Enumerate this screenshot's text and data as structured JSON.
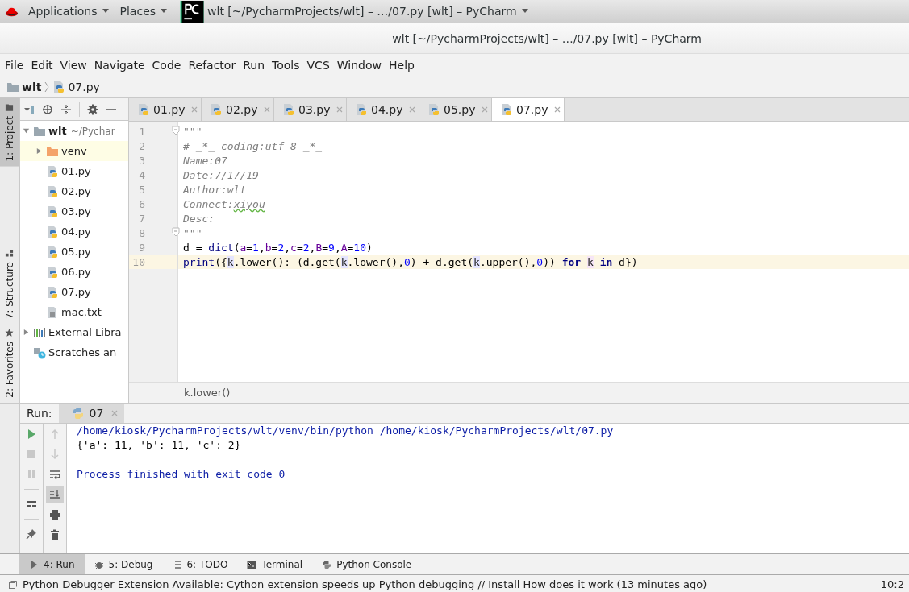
{
  "top_bar": {
    "menus": [
      "Applications",
      "Places"
    ],
    "window_title": "wlt [~/PycharmProjects/wlt] – …/07.py [wlt] – PyCharm"
  },
  "window": {
    "title": "wlt [~/PycharmProjects/wlt] – …/07.py [wlt] – PyCharm"
  },
  "menu_bar": [
    "File",
    "Edit",
    "View",
    "Navigate",
    "Code",
    "Refactor",
    "Run",
    "Tools",
    "VCS",
    "Window",
    "Help"
  ],
  "breadcrumb": [
    {
      "label": "wlt",
      "kind": "folder"
    },
    {
      "label": "07.py",
      "kind": "py"
    }
  ],
  "side_stripe": {
    "top": [
      {
        "label": "1: Project",
        "selected": true
      }
    ],
    "bottom": [
      {
        "label": "7: Structure",
        "selected": false
      },
      {
        "label": "2: Favorites",
        "selected": false
      }
    ]
  },
  "project_tree": [
    {
      "label": "wlt",
      "hint": "~/Pychar",
      "kind": "folder",
      "expanded": true,
      "selected": false,
      "children": [
        {
          "label": "venv",
          "kind": "venv",
          "expanded": false,
          "selected": true
        },
        {
          "label": "01.py",
          "kind": "py",
          "selected": false
        },
        {
          "label": "02.py",
          "kind": "py",
          "selected": false
        },
        {
          "label": "03.py",
          "kind": "py",
          "selected": false
        },
        {
          "label": "04.py",
          "kind": "py",
          "selected": false
        },
        {
          "label": "05.py",
          "kind": "py",
          "selected": false
        },
        {
          "label": "06.py",
          "kind": "py",
          "selected": false
        },
        {
          "label": "07.py",
          "kind": "py",
          "selected": false
        },
        {
          "label": "mac.txt",
          "kind": "txt",
          "selected": false
        }
      ]
    },
    {
      "label": "External Libra",
      "kind": "library",
      "expanded": false,
      "selected": false
    },
    {
      "label": "Scratches an",
      "kind": "scratches",
      "selected": false
    }
  ],
  "tabs": [
    {
      "label": "01.py",
      "selected": false
    },
    {
      "label": "02.py",
      "selected": false
    },
    {
      "label": "03.py",
      "selected": false
    },
    {
      "label": "04.py",
      "selected": false
    },
    {
      "label": "05.py",
      "selected": false
    },
    {
      "label": "07.py",
      "selected": true
    }
  ],
  "editor": {
    "lines": [
      {
        "number": "1",
        "fold": true,
        "current": false,
        "tokens": [
          {
            "t": "\"\"\"",
            "kind": "doc"
          }
        ]
      },
      {
        "number": "2",
        "fold": false,
        "current": false,
        "tokens": [
          {
            "t": "# _*_ coding:utf-8 _*_",
            "kind": "doc"
          }
        ]
      },
      {
        "number": "3",
        "fold": false,
        "current": false,
        "tokens": [
          {
            "t": "Name:07",
            "kind": "doc"
          }
        ]
      },
      {
        "number": "4",
        "fold": false,
        "current": false,
        "tokens": [
          {
            "t": "Date:7/17/19",
            "kind": "doc"
          }
        ]
      },
      {
        "number": "5",
        "fold": false,
        "current": false,
        "tokens": [
          {
            "t": "Author:wlt",
            "kind": "doc"
          }
        ]
      },
      {
        "number": "6",
        "fold": false,
        "current": false,
        "tokens": [
          {
            "t": "Connect:",
            "kind": "doc"
          },
          {
            "t": "xiyou",
            "kind": "typo"
          }
        ]
      },
      {
        "number": "7",
        "fold": false,
        "current": false,
        "tokens": [
          {
            "t": "Desc:",
            "kind": "doc"
          }
        ]
      },
      {
        "number": "8",
        "fold": true,
        "current": false,
        "tokens": [
          {
            "t": "\"\"\"",
            "kind": "doc"
          }
        ]
      },
      {
        "number": "9",
        "fold": false,
        "current": false,
        "tokens": [
          {
            "t": "d = ",
            "kind": "text"
          },
          {
            "t": "dict",
            "kind": "builtin"
          },
          {
            "t": "(",
            "kind": "text"
          },
          {
            "t": "a",
            "kind": "param"
          },
          {
            "t": "=",
            "kind": "text"
          },
          {
            "t": "1",
            "kind": "num"
          },
          {
            "t": ",",
            "kind": "text"
          },
          {
            "t": "b",
            "kind": "param"
          },
          {
            "t": "=",
            "kind": "text"
          },
          {
            "t": "2",
            "kind": "num"
          },
          {
            "t": ",",
            "kind": "text"
          },
          {
            "t": "c",
            "kind": "param"
          },
          {
            "t": "=",
            "kind": "text"
          },
          {
            "t": "2",
            "kind": "num"
          },
          {
            "t": ",",
            "kind": "text"
          },
          {
            "t": "B",
            "kind": "param"
          },
          {
            "t": "=",
            "kind": "text"
          },
          {
            "t": "9",
            "kind": "num"
          },
          {
            "t": ",",
            "kind": "text"
          },
          {
            "t": "A",
            "kind": "param"
          },
          {
            "t": "=",
            "kind": "text"
          },
          {
            "t": "10",
            "kind": "num"
          },
          {
            "t": ")",
            "kind": "text"
          }
        ]
      },
      {
        "number": "10",
        "fold": false,
        "current": true,
        "tokens": [
          {
            "t": "print",
            "kind": "builtin"
          },
          {
            "t": "({",
            "kind": "text"
          },
          {
            "t": "k",
            "kind": "ref"
          },
          {
            "t": ".lower(): (d.get(",
            "kind": "text"
          },
          {
            "t": "k",
            "kind": "ref"
          },
          {
            "t": ".lower(),",
            "kind": "text"
          },
          {
            "t": "0",
            "kind": "num"
          },
          {
            "t": ") + d.get(",
            "kind": "text"
          },
          {
            "t": "k",
            "kind": "ref"
          },
          {
            "t": ".upper(),",
            "kind": "text"
          },
          {
            "t": "0",
            "kind": "num"
          },
          {
            "t": ")) ",
            "kind": "text"
          },
          {
            "t": "for ",
            "kind": "kw"
          },
          {
            "t": "k",
            "kind": "decl"
          },
          {
            "t": " in",
            "kind": "kw"
          },
          {
            "t": " d})",
            "kind": "text"
          }
        ]
      }
    ],
    "hint": "k.lower()"
  },
  "run_panel": {
    "label": "Run:",
    "tab": "07",
    "output": [
      {
        "text": "/home/kiosk/PycharmProjects/wlt/venv/bin/python /home/kiosk/PycharmProjects/wlt/07.py",
        "kind": "system"
      },
      {
        "text": "{'a': 11, 'b': 11, 'c': 2}",
        "kind": "stdout"
      },
      {
        "text": "Process finished with exit code 0",
        "kind": "footer"
      }
    ]
  },
  "tool_tabs": [
    {
      "label": "4: Run",
      "kind": "run",
      "selected": true
    },
    {
      "label": "5: Debug",
      "kind": "debug",
      "selected": false
    },
    {
      "label": "6: TODO",
      "kind": "todo",
      "selected": false
    },
    {
      "label": "Terminal",
      "kind": "terminal",
      "selected": false
    },
    {
      "label": "Python Console",
      "kind": "console",
      "selected": false
    }
  ],
  "status_bar": {
    "message": "Python Debugger Extension Available: Cython extension speeds up Python debugging // Install How does it work (13 minutes ago)",
    "position": "10:2"
  }
}
